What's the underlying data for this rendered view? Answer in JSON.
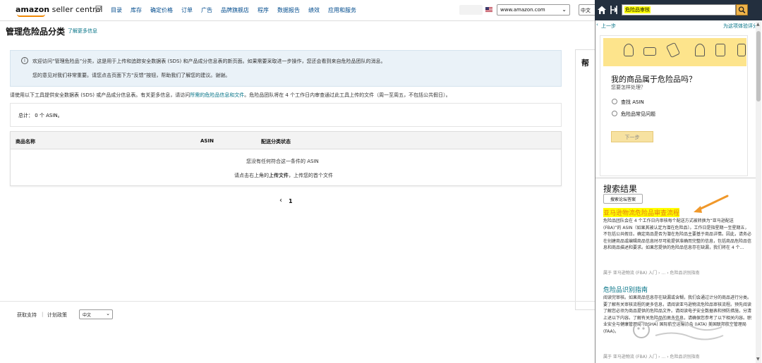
{
  "header": {
    "logo_main": "amazon",
    "logo_sub": " seller central",
    "nav": [
      "目录",
      "库存",
      "确定价格",
      "订单",
      "广告",
      "品牌旗舰店",
      "程序",
      "数据报告",
      "绩效",
      "应用和服务"
    ],
    "marketplace": "www.amazon.com",
    "lang_button": "中文"
  },
  "main": {
    "title": "管理危险品分类",
    "learn_more": "了解更多信息",
    "info_line1": "欢迎访问“管理危险品”分类，这是用于上传和追踪安全数据表 (SDS) 和产品成分信息表的新页面。如果需要采取进一步操作，您还会看到来自危险品团队的消息。",
    "info_line2": "您的意见对我们非常重要。请您点击页面下方“反馈”按钮，帮助我们了解您的建议。谢谢。",
    "desc_pre": "请使用以下工具提供安全数据表 (SDS) 或产品成分信息表。有关更多信息，请访问",
    "desc_link": "所需的危险品信息和文件",
    "desc_post": "。危险品团队将在 4 个工作日内审查通过此工具上传的文件（周一至周五，不包括公共假日）。",
    "total": "总计： 0 个 ASIN。",
    "columns": [
      "商品名称",
      "ASIN",
      "配送分类状态"
    ],
    "empty1": "您没有任何符合这一条件的 ASIN",
    "empty2_pre": "请点击右上角的",
    "empty2_bold": "上传文件",
    "empty2_post": "，上传您的首个文件",
    "pager_prev": "‹",
    "page": "1",
    "help_title": "帮"
  },
  "footer": {
    "help": "获取支持",
    "sep": "|",
    "plan": "计划政策",
    "lang": "中文"
  },
  "panel": {
    "search_value": "危险品审核",
    "prev": "上一步",
    "forum": "为这项体验评分",
    "question": "我的商品属于危险品吗？",
    "question_sub": "您要怎样处理？",
    "option1": "查找 ASIN",
    "option2": "危险品常见问题",
    "next": "下一步",
    "results_title": "搜索结果",
    "forum_btn": "搜索论坛答案",
    "result1_title": "亚马逊物流危险品审查流程",
    "result1_body": "危险品团队会在 4 个工作日内审核每个配送方式被转换为“亚马逊配送 (FBA)”的 ASIN（如果其被认定为潜在危险品）。工作日是指星期一至星期五，不包括公共假日。确定商品是否为潜在危险品主要基于商品详情。因此，请务必在创建商品或编辑商品信息时尽可能提供准确而完整的信息，包括商品危险品信息和商品描述和要求。如果您提供的危险品信息存在缺漏，我们将在 4 个…",
    "result1_crumb": "属于 亚马逊物流 (FBA) 入门 › … › 危险品识别指南",
    "result2_title": "危险品识别指南",
    "result2_body": "阅读完审核。如果商品信息存在缺漏或含糊，我们会通过计分的商品进行分类。要了解有关审核流程的更多信息，请阅读亚马逊物流危险品审核流程。预先阅读了解您必须为商品提供的危险品文件。请阅读电子安全数据表和预防措施，分清上述以下内容。了解有关危险品的更多信息，请确保您参考了以下相关内容。职业安全与健康管理局 (OSHA) 国际航空运输协会 (IATA) 美国联邦航空管理局 (FAA)。",
    "result2_crumb": "属于 亚马逊物流 (FBA) 入门 › … › 危险品识别指南"
  },
  "colors": {
    "link": "#007185",
    "nav_link": "#004b8d",
    "panel_bar": "#232f3e",
    "banner": "#fde48c",
    "highlight": "#ffff00",
    "orange": "#e47911"
  }
}
